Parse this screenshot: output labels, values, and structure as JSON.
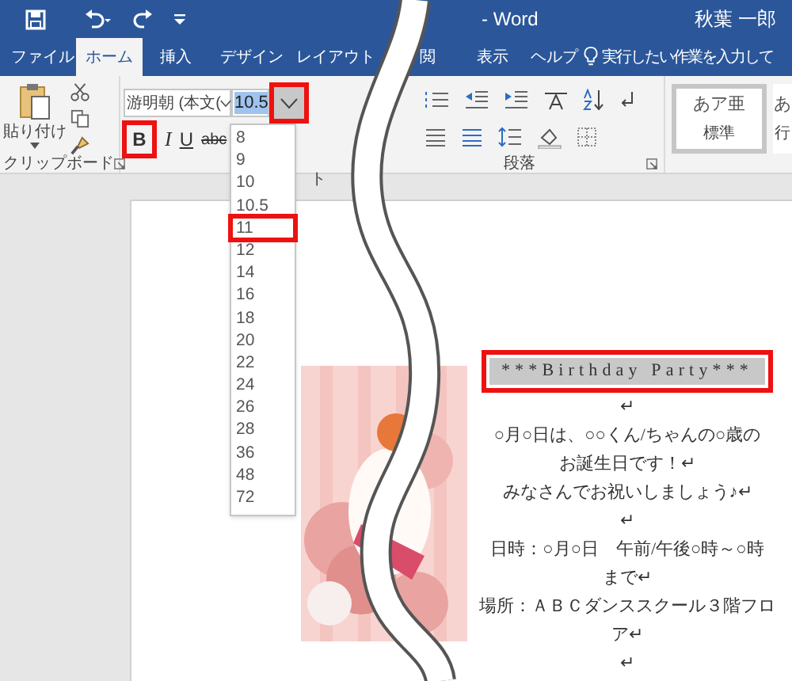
{
  "title_bar": {
    "title": "- Word",
    "user": "秋葉 一郎"
  },
  "tabs": [
    {
      "label": "ファイル",
      "selected": false
    },
    {
      "label": "ホーム",
      "selected": true
    },
    {
      "label": "挿入",
      "selected": false
    },
    {
      "label": "デザイン",
      "selected": false
    },
    {
      "label": "レイアウト",
      "selected": false
    },
    {
      "label": "閲",
      "selected": false
    },
    {
      "label": "表示",
      "selected": false
    },
    {
      "label": "ヘルプ",
      "selected": false
    }
  ],
  "tell_me": {
    "placeholder": "実行したい作業を入力して"
  },
  "ribbon": {
    "paste_label": "貼り付け",
    "font_name": "游明朝 (本文(",
    "font_size": "10.5",
    "size_dropdown_annotated": true,
    "format_buttons": [
      {
        "label": "B",
        "annotated": true
      },
      {
        "label": "I",
        "annotated": false
      },
      {
        "label": "U",
        "annotated": false
      },
      {
        "label": "abc",
        "annotated": false
      }
    ],
    "styles": [
      {
        "preview": "あア亜",
        "name": "標準",
        "selected": true
      },
      {
        "preview": "あ",
        "name": "行",
        "selected": false
      }
    ],
    "group_labels": [
      "クリップボード",
      "ト",
      "段落"
    ]
  },
  "size_list": [
    {
      "label": "8",
      "annotated": false
    },
    {
      "label": "9",
      "annotated": false
    },
    {
      "label": "10",
      "annotated": false
    },
    {
      "label": "10.5",
      "annotated": false
    },
    {
      "label": "11",
      "annotated": true
    },
    {
      "label": "12",
      "annotated": false
    },
    {
      "label": "14",
      "annotated": false
    },
    {
      "label": "16",
      "annotated": false
    },
    {
      "label": "18",
      "annotated": false
    },
    {
      "label": "20",
      "annotated": false
    },
    {
      "label": "22",
      "annotated": false
    },
    {
      "label": "24",
      "annotated": false
    },
    {
      "label": "26",
      "annotated": false
    },
    {
      "label": "28",
      "annotated": false
    },
    {
      "label": "36",
      "annotated": false
    },
    {
      "label": "48",
      "annotated": false
    },
    {
      "label": "72",
      "annotated": false
    }
  ],
  "document": {
    "heading": {
      "text": "***Birthday Party***",
      "annotated": true
    },
    "lines": [
      "↵",
      "○月○日は、○○くん/ちゃんの○歳の",
      "お誕生日です！↵",
      "みなさんでお祝いしましょう♪↵",
      "↵",
      "日時：○月○日　午前/午後○時～○時",
      "まで↵",
      "場所：ＡＢＣダンススクール３階フロ",
      "ア↵",
      "↵"
    ]
  }
}
